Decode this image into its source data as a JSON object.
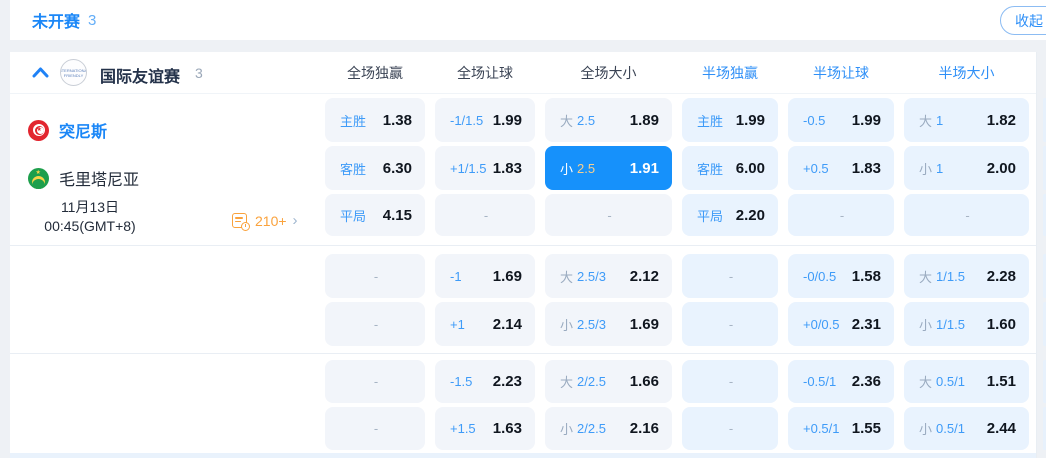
{
  "topbar": {
    "title": "未开赛",
    "count": "3",
    "collapse_label": "收起"
  },
  "league": {
    "name": "国际友谊赛",
    "count": "3",
    "logo_text": "INTERNATIONAL FRIENDLY"
  },
  "columns": [
    {
      "label": "全场独赢",
      "half": false
    },
    {
      "label": "全场让球",
      "half": false
    },
    {
      "label": "全场大小",
      "half": false
    },
    {
      "label": "半场独赢",
      "half": true
    },
    {
      "label": "半场让球",
      "half": true
    },
    {
      "label": "半场大小",
      "half": true
    }
  ],
  "match": {
    "home": "突尼斯",
    "away": "毛里塔尼亚",
    "date": "11月13日",
    "time": "00:45(GMT+8)",
    "markets_count": "210+"
  },
  "odds": {
    "groups": [
      {
        "rows": [
          [
            {
              "label": "主胜",
              "value": "1.38"
            },
            {
              "label": "-1/1.5",
              "value": "1.99"
            },
            {
              "big": "大",
              "line": "2.5",
              "value": "1.89"
            },
            {
              "label": "主胜",
              "value": "1.99"
            },
            {
              "label": "-0.5",
              "value": "1.99"
            },
            {
              "big": "大",
              "line": "1",
              "value": "1.82"
            }
          ],
          [
            {
              "label": "客胜",
              "value": "6.30"
            },
            {
              "label": "+1/1.5",
              "value": "1.83"
            },
            {
              "big": "小",
              "line": "2.5",
              "value": "1.91",
              "selected": true
            },
            {
              "label": "客胜",
              "value": "6.00"
            },
            {
              "label": "+0.5",
              "value": "1.83"
            },
            {
              "big": "小",
              "line": "1",
              "value": "2.00"
            }
          ],
          [
            {
              "label": "平局",
              "value": "4.15"
            },
            {
              "dash": true
            },
            {
              "dash": true
            },
            {
              "label": "平局",
              "value": "2.20"
            },
            {
              "dash": true
            },
            {
              "dash": true
            }
          ]
        ]
      },
      {
        "rows": [
          [
            {
              "dash": true
            },
            {
              "label": "-1",
              "value": "1.69"
            },
            {
              "big": "大",
              "line": "2.5/3",
              "value": "2.12"
            },
            {
              "dash": true
            },
            {
              "label": "-0/0.5",
              "value": "1.58"
            },
            {
              "big": "大",
              "line": "1/1.5",
              "value": "2.28"
            }
          ],
          [
            {
              "dash": true
            },
            {
              "label": "+1",
              "value": "2.14"
            },
            {
              "big": "小",
              "line": "2.5/3",
              "value": "1.69"
            },
            {
              "dash": true
            },
            {
              "label": "+0/0.5",
              "value": "2.31"
            },
            {
              "big": "小",
              "line": "1/1.5",
              "value": "1.60"
            }
          ]
        ]
      },
      {
        "rows": [
          [
            {
              "dash": true
            },
            {
              "label": "-1.5",
              "value": "2.23"
            },
            {
              "big": "大",
              "line": "2/2.5",
              "value": "1.66"
            },
            {
              "dash": true
            },
            {
              "label": "-0.5/1",
              "value": "2.36"
            },
            {
              "big": "大",
              "line": "0.5/1",
              "value": "1.51"
            }
          ],
          [
            {
              "dash": true
            },
            {
              "label": "+1.5",
              "value": "1.63"
            },
            {
              "big": "小",
              "line": "2/2.5",
              "value": "2.16"
            },
            {
              "dash": true
            },
            {
              "label": "+0.5/1",
              "value": "1.55"
            },
            {
              "big": "小",
              "line": "0.5/1",
              "value": "2.44"
            }
          ]
        ]
      }
    ]
  },
  "colors": {
    "accent_blue": "#1b87f7",
    "selected_cell_bg": "#1691fb",
    "selected_line_gold": "#f8cf8d",
    "full_cell_bg": "#f2f5fa",
    "half_cell_bg": "#e9f3fe",
    "orange_link": "#faa23c"
  }
}
